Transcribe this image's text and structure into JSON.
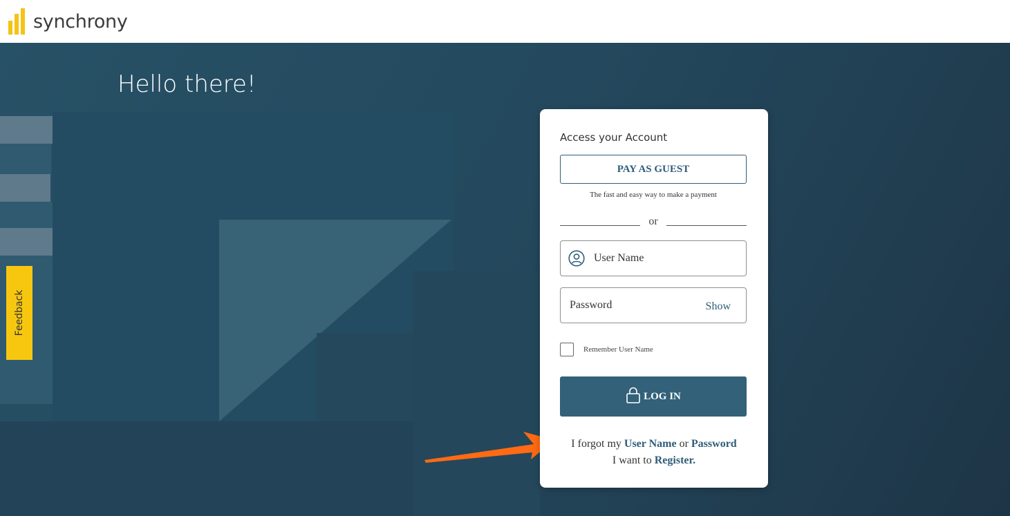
{
  "brand": {
    "name": "synchrony",
    "mark_color": "#f4c313"
  },
  "hero": {
    "greeting": "Hello there!"
  },
  "feedback": {
    "label": "Feedback"
  },
  "login_card": {
    "title": "Access your Account",
    "guest_button": "PAY AS GUEST",
    "guest_subtitle": "The fast and easy way to make a payment",
    "divider": "or",
    "username_placeholder": "User Name",
    "password_placeholder": "Password",
    "show_label": "Show",
    "remember_label": "Remember User Name",
    "login_button": "LOG IN",
    "forgot": {
      "prefix": "I forgot my",
      "user_name": "User Name",
      "or": "or",
      "password": "Password"
    },
    "register": {
      "prefix": "I want to",
      "link": "Register."
    }
  },
  "colors": {
    "accent": "#2f5d78",
    "button": "#326179",
    "feedback": "#f7c710",
    "annotation_arrow": "#ff6a13"
  },
  "icons": {
    "username": "user-circle-icon",
    "login": "lock-icon",
    "annotation": "arrow-icon"
  }
}
